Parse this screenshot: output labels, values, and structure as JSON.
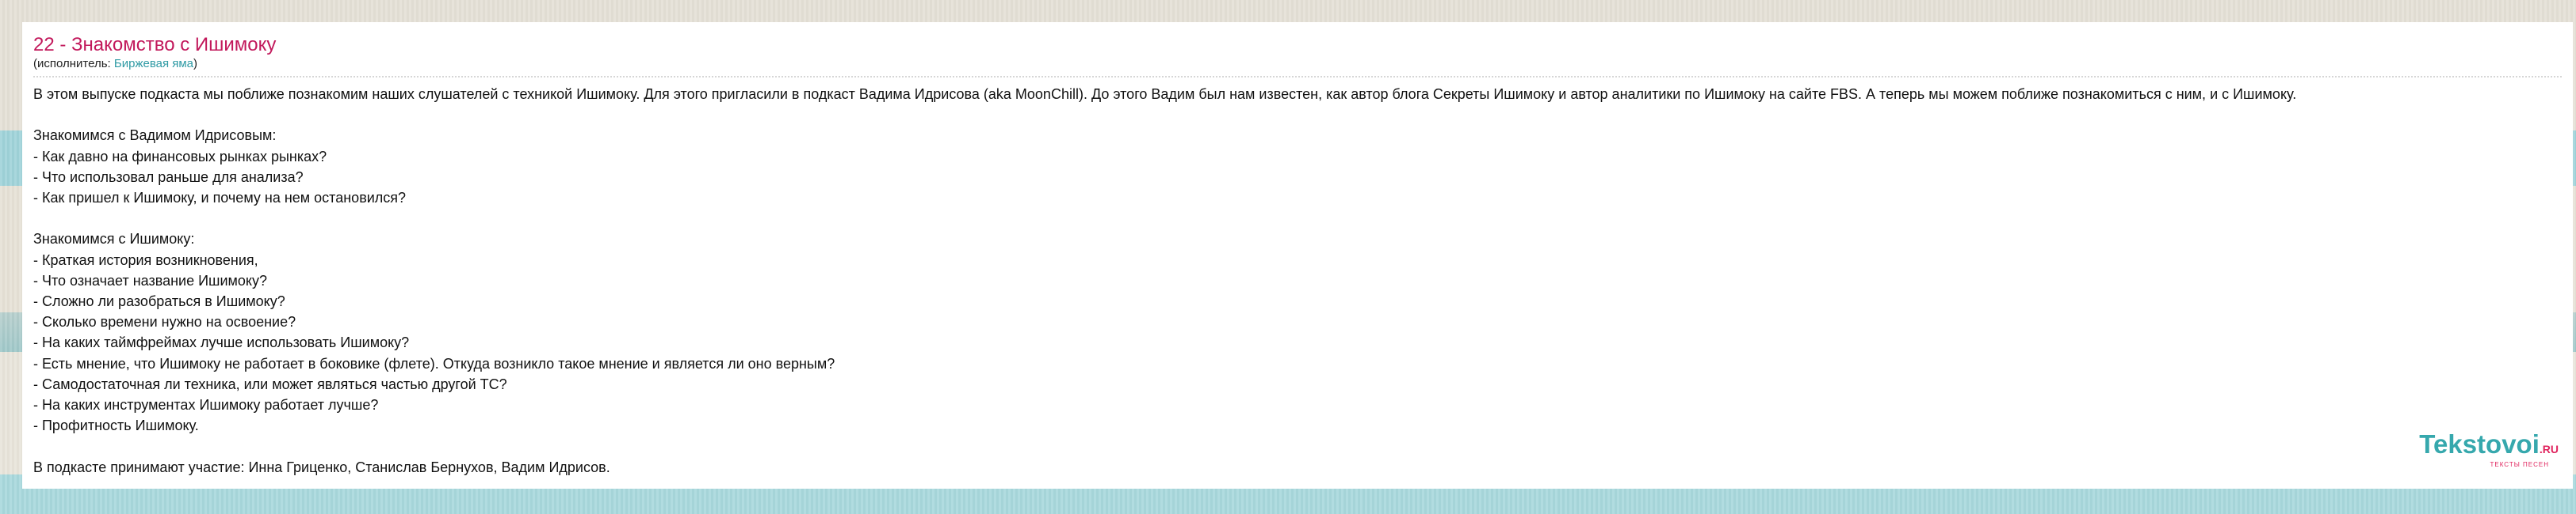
{
  "song": {
    "title": "22 - Знакомство с Ишимоку",
    "performer_prefix": "(исполнитель: ",
    "performer_name": "Биржевая яма",
    "performer_suffix": ")"
  },
  "lyrics": {
    "intro": "В этом выпуске подкаста мы поближе познакомим наших слушателей с техникой Ишимоку. Для этого пригласили в подкаст Вадима Идрисова (aka MoonChill). До этого Вадим был нам известен, как автор блога Секреты Ишимоку и автор аналитики по Ишимоку на сайте FBS. А теперь мы можем поближе познакомиться с ним, и с Ишимоку.",
    "section1": [
      "Знакомимся с Вадимом Идрисовым:",
      "- Как давно на финансовых рынках рынках?",
      "- Что использовал раньше для анализа?",
      "- Как пришел к Ишимоку, и почему на нем остановился?"
    ],
    "section2": [
      "Знакомимся с Ишимоку:",
      "- Краткая история возникновения,",
      "- Что означает название Ишимоку?",
      "- Сложно ли разобраться в Ишимоку?",
      "- Сколько времени нужно на освоение?",
      "- На каких таймфреймах лучше использовать Ишимоку?",
      "- Есть мнение, что Ишимоку не работает в боковике (флете). Откуда возникло такое мнение и является ли оно верным?",
      "- Самодостаточная ли техника, или может являться частью другой ТС?",
      "- На каких инструментах Ишимоку работает лучше?",
      "- Профитность Ишимоку."
    ],
    "outro": "В подкасте принимают участие: Инна Гриценко, Станислав Бернухов, Вадим Идрисов."
  },
  "logo": {
    "name": "Tekstovoi",
    "tld": ".RU",
    "tagline": "ТЕКСТЫ ПЕСЕН"
  }
}
